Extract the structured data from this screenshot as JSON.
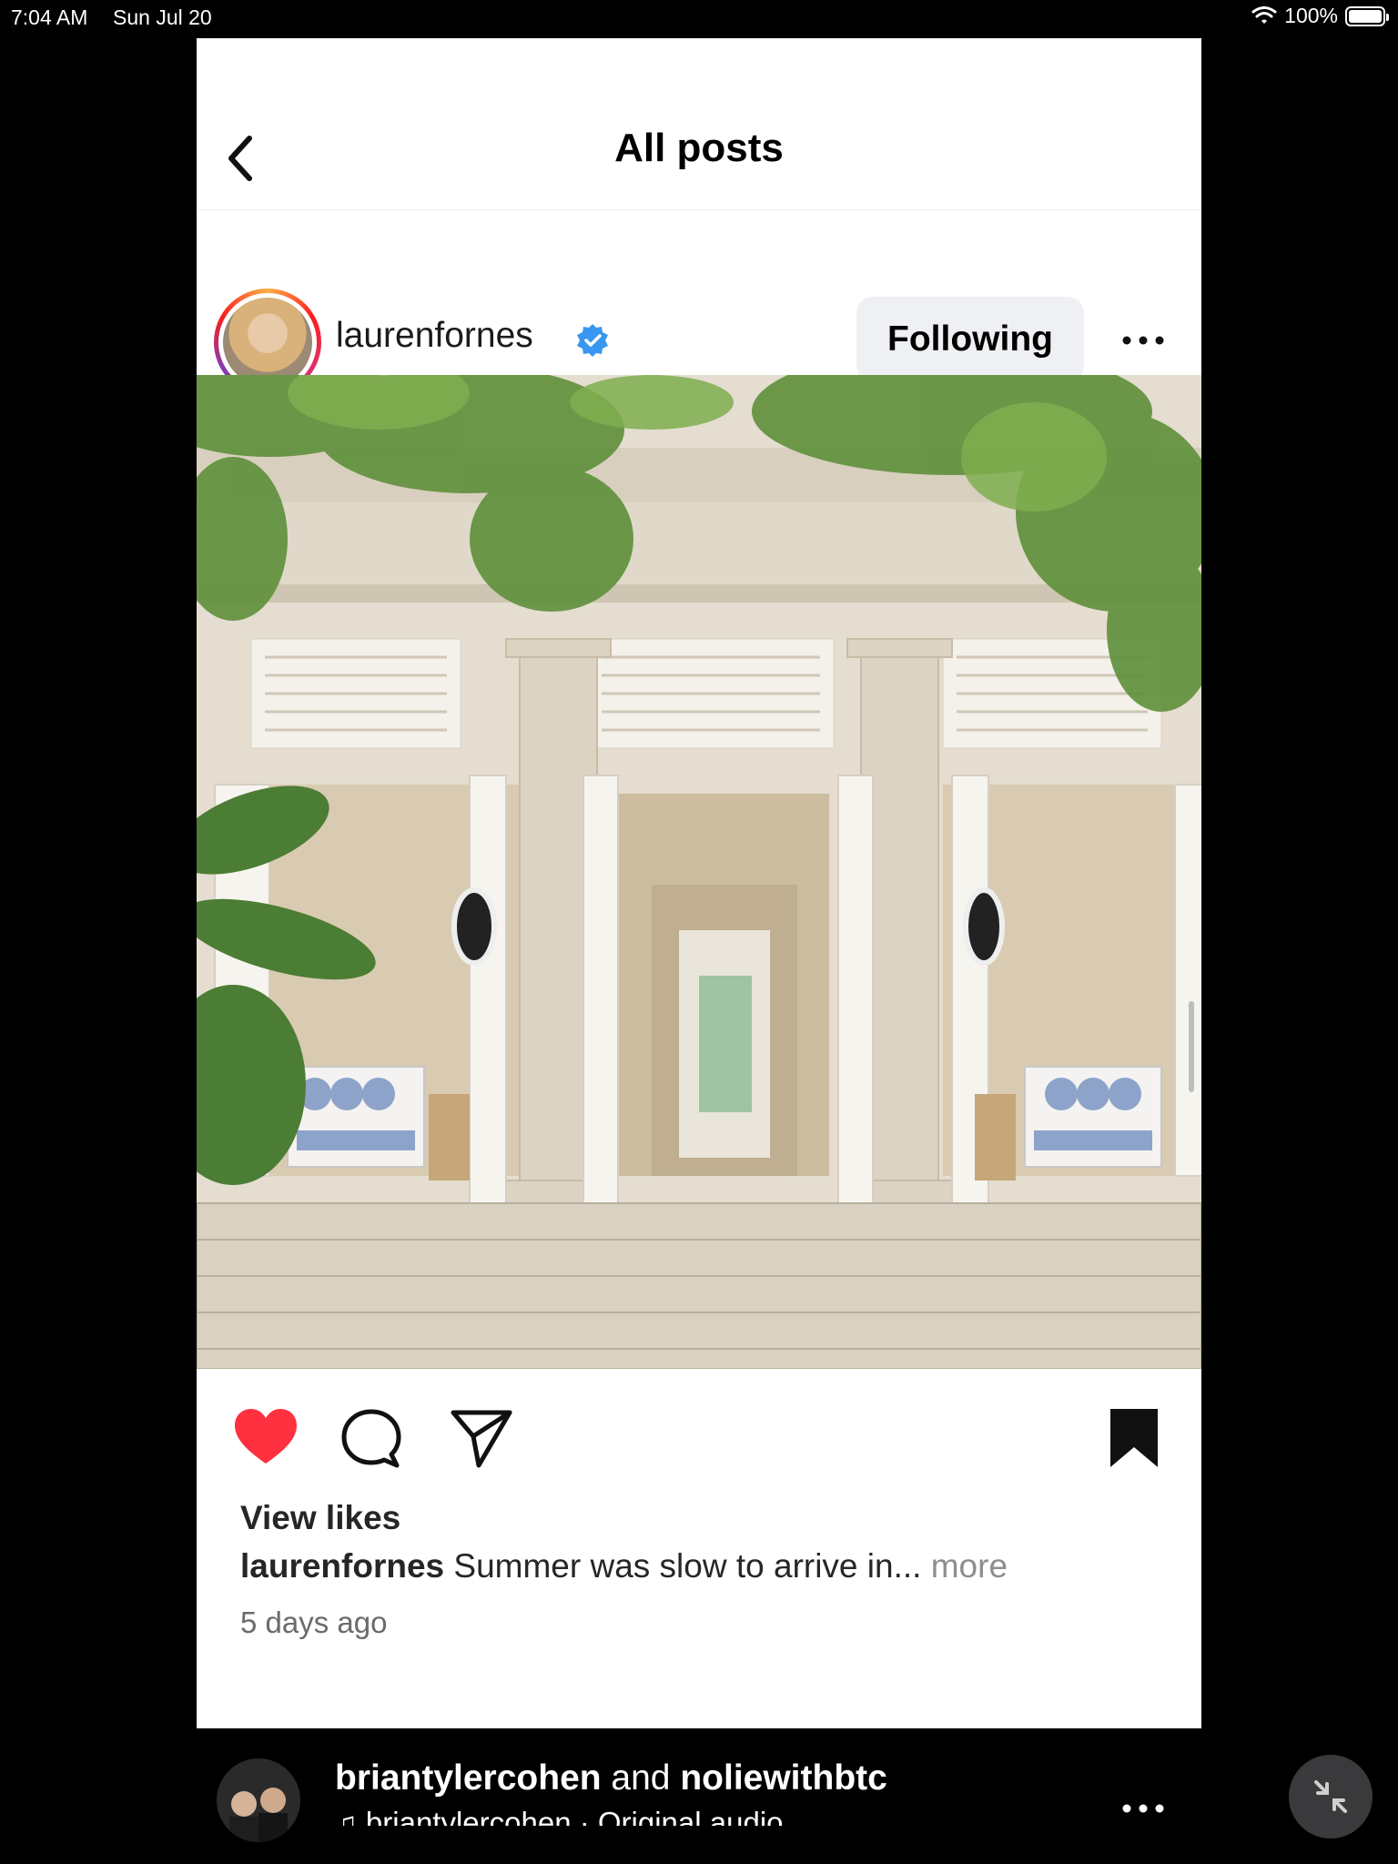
{
  "status_bar": {
    "time": "7:04 AM",
    "date": "Sun Jul 20",
    "battery": "100%"
  },
  "nav": {
    "title": "All posts"
  },
  "post": {
    "username": "laurenfornes",
    "follow_label": "Following",
    "view_likes": "View likes",
    "caption_user": "laurenfornes",
    "caption_text": "Summer was slow to arrive in...",
    "caption_more": "more",
    "time_ago": "5 days ago"
  },
  "next_post": {
    "user1": "briantylercohen",
    "and": "and",
    "user2": "noliewithbtc",
    "audio": "briantylercohen · Original audio"
  },
  "colors": {
    "like": "#ff3040",
    "verified": "#3897f0"
  }
}
